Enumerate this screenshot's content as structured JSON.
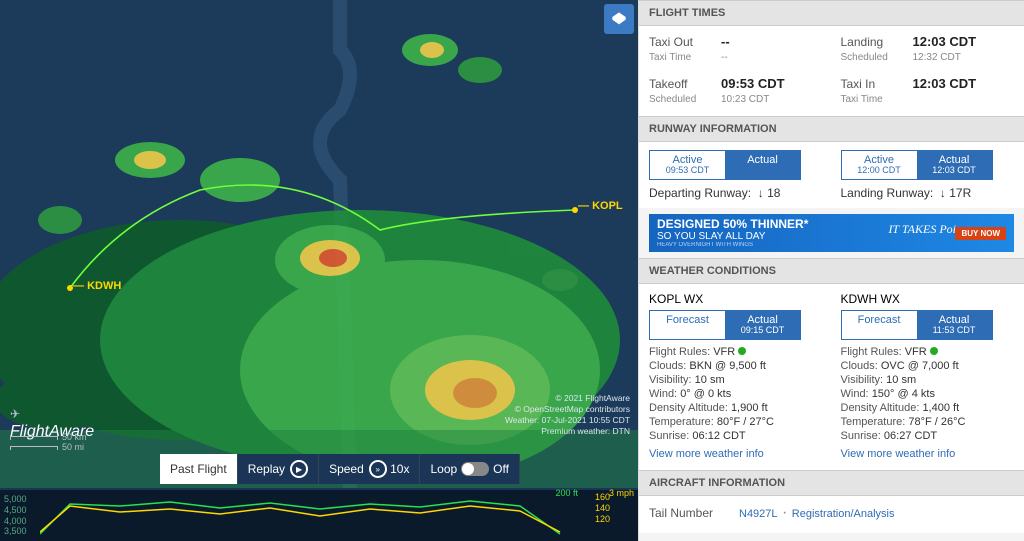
{
  "map": {
    "logo": "FlightAware",
    "credits": {
      "l1": "© 2021 FlightAware",
      "l2": "© OpenStreetMap contributors",
      "l3": "Weather: 07-Jul-2021 10:55 CDT",
      "l4": "Premium weather: DTN"
    },
    "scale": {
      "km": "50 km",
      "mi": "50 mi"
    },
    "waypoints": {
      "origin": "KDWH",
      "dest": "KOPL"
    },
    "controls": {
      "mode": "Past Flight",
      "replay": "Replay",
      "speed_lbl": "Speed",
      "speed_val": "10x",
      "loop": "Loop",
      "loop_state": "Off"
    },
    "chart": {
      "alt_axis": [
        "5,000",
        "4,500",
        "4,000",
        "3,500"
      ],
      "spd_axis": [
        "160",
        "140",
        "120"
      ],
      "alt_label": "200 ft",
      "spd_label": "3 mph"
    }
  },
  "flight_times": {
    "hdr": "FLIGHT TIMES",
    "taxi_out_lbl": "Taxi Out",
    "taxi_out": "--",
    "taxi_time_lbl": "Taxi Time",
    "taxi_time": "--",
    "takeoff_lbl": "Takeoff",
    "takeoff": "09:53 CDT",
    "takeoff_sched_lbl": "Scheduled",
    "takeoff_sched": "10:23 CDT",
    "landing_lbl": "Landing",
    "landing": "12:03 CDT",
    "landing_sched_lbl": "Scheduled",
    "landing_sched": "12:32 CDT",
    "taxi_in_lbl": "Taxi In",
    "taxi_in": "12:03 CDT",
    "taxi_time2_lbl": "Taxi Time",
    "taxi_time2": ""
  },
  "runway": {
    "hdr": "RUNWAY INFORMATION",
    "dep": {
      "active_lbl": "Active",
      "active_ts": "09:53 CDT",
      "actual_lbl": "Actual",
      "actual_ts": ""
    },
    "arr": {
      "active_lbl": "Active",
      "active_ts": "12:00 CDT",
      "actual_lbl": "Actual",
      "actual_ts": "12:03 CDT"
    },
    "dep_rwy_lbl": "Departing Runway:",
    "dep_rwy": "↓ 18",
    "arr_rwy_lbl": "Landing Runway:",
    "arr_rwy": "↓ 17R"
  },
  "ad": {
    "line1": "DESIGNED 50% THINNER*",
    "line2": "SO YOU SLAY ALL DAY",
    "fine": "HEAVY OVERNIGHT WITH WINGS",
    "tag": "IT TAKES Poise",
    "cta": "BUY NOW"
  },
  "wx": {
    "hdr": "WEATHER CONDITIONS",
    "kopl": {
      "name": "KOPL WX",
      "forecast": "Forecast",
      "actual": "Actual",
      "actual_ts": "09:15 CDT",
      "rules_k": "Flight Rules:",
      "rules_v": "VFR",
      "clouds_k": "Clouds:",
      "clouds_v": "BKN @ 9,500 ft",
      "vis_k": "Visibility:",
      "vis_v": "10 sm",
      "wind_k": "Wind:",
      "wind_v": "0° @ 0 kts",
      "da_k": "Density Altitude:",
      "da_v": "1,900 ft",
      "temp_k": "Temperature:",
      "temp_v": "80°F / 27°C",
      "sun_k": "Sunrise:",
      "sun_v": "06:12 CDT",
      "link": "View more weather info"
    },
    "kdwh": {
      "name": "KDWH WX",
      "forecast": "Forecast",
      "actual": "Actual",
      "actual_ts": "11:53 CDT",
      "rules_k": "Flight Rules:",
      "rules_v": "VFR",
      "clouds_k": "Clouds:",
      "clouds_v": "OVC @ 7,000 ft",
      "vis_k": "Visibility:",
      "vis_v": "10 sm",
      "wind_k": "Wind:",
      "wind_v": "150° @ 4 kts",
      "da_k": "Density Altitude:",
      "da_v": "1,400 ft",
      "temp_k": "Temperature:",
      "temp_v": "78°F / 26°C",
      "sun_k": "Sunrise:",
      "sun_v": "06:27 CDT",
      "link": "View more weather info"
    }
  },
  "acft": {
    "hdr": "AIRCRAFT INFORMATION",
    "tail_lbl": "Tail Number",
    "tail": "N4927L",
    "reg": "Registration/Analysis"
  }
}
